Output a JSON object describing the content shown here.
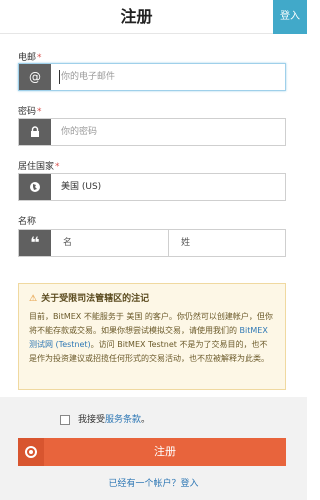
{
  "header": {
    "title": "注册",
    "login_button": "登入"
  },
  "form": {
    "email": {
      "label": "电邮",
      "required": "*",
      "placeholder": "你的电子邮件",
      "icon": "at-icon"
    },
    "password": {
      "label": "密码",
      "required": "*",
      "placeholder": "你的密码",
      "icon": "lock-icon"
    },
    "country": {
      "label": "居住国家",
      "required": "*",
      "value": "美国 (US)",
      "icon": "globe-icon"
    },
    "name": {
      "label": "名称",
      "icon": "quote-icon",
      "first_placeholder": "名",
      "last_placeholder": "姓"
    }
  },
  "notice": {
    "title": "关于受限司法管辖区的注记",
    "body_1": "目前，BitMEX 不能服务于 美国 的客户。你仍然可以创建帐户，但你将不能存款或交易。如果你想尝试模拟交易，请使用我们的 ",
    "link": "BitMEX 测试网 (Testnet)",
    "body_2": "。访问 BitMEX Testnet 不是为了交易目的，也不是作为投资建议或招揽任何形式的交易活动，也不应被解释为此类。"
  },
  "footer": {
    "agree_prefix": "我接受",
    "agree_link": "服务条款",
    "agree_suffix": "。",
    "register_button": "注册",
    "have_account": "已经有一个帐户？登入"
  },
  "colors": {
    "accent": "#41a9c9",
    "register": "#e8643c",
    "link": "#2f78b5",
    "notice_bg": "#fdf7e6"
  }
}
